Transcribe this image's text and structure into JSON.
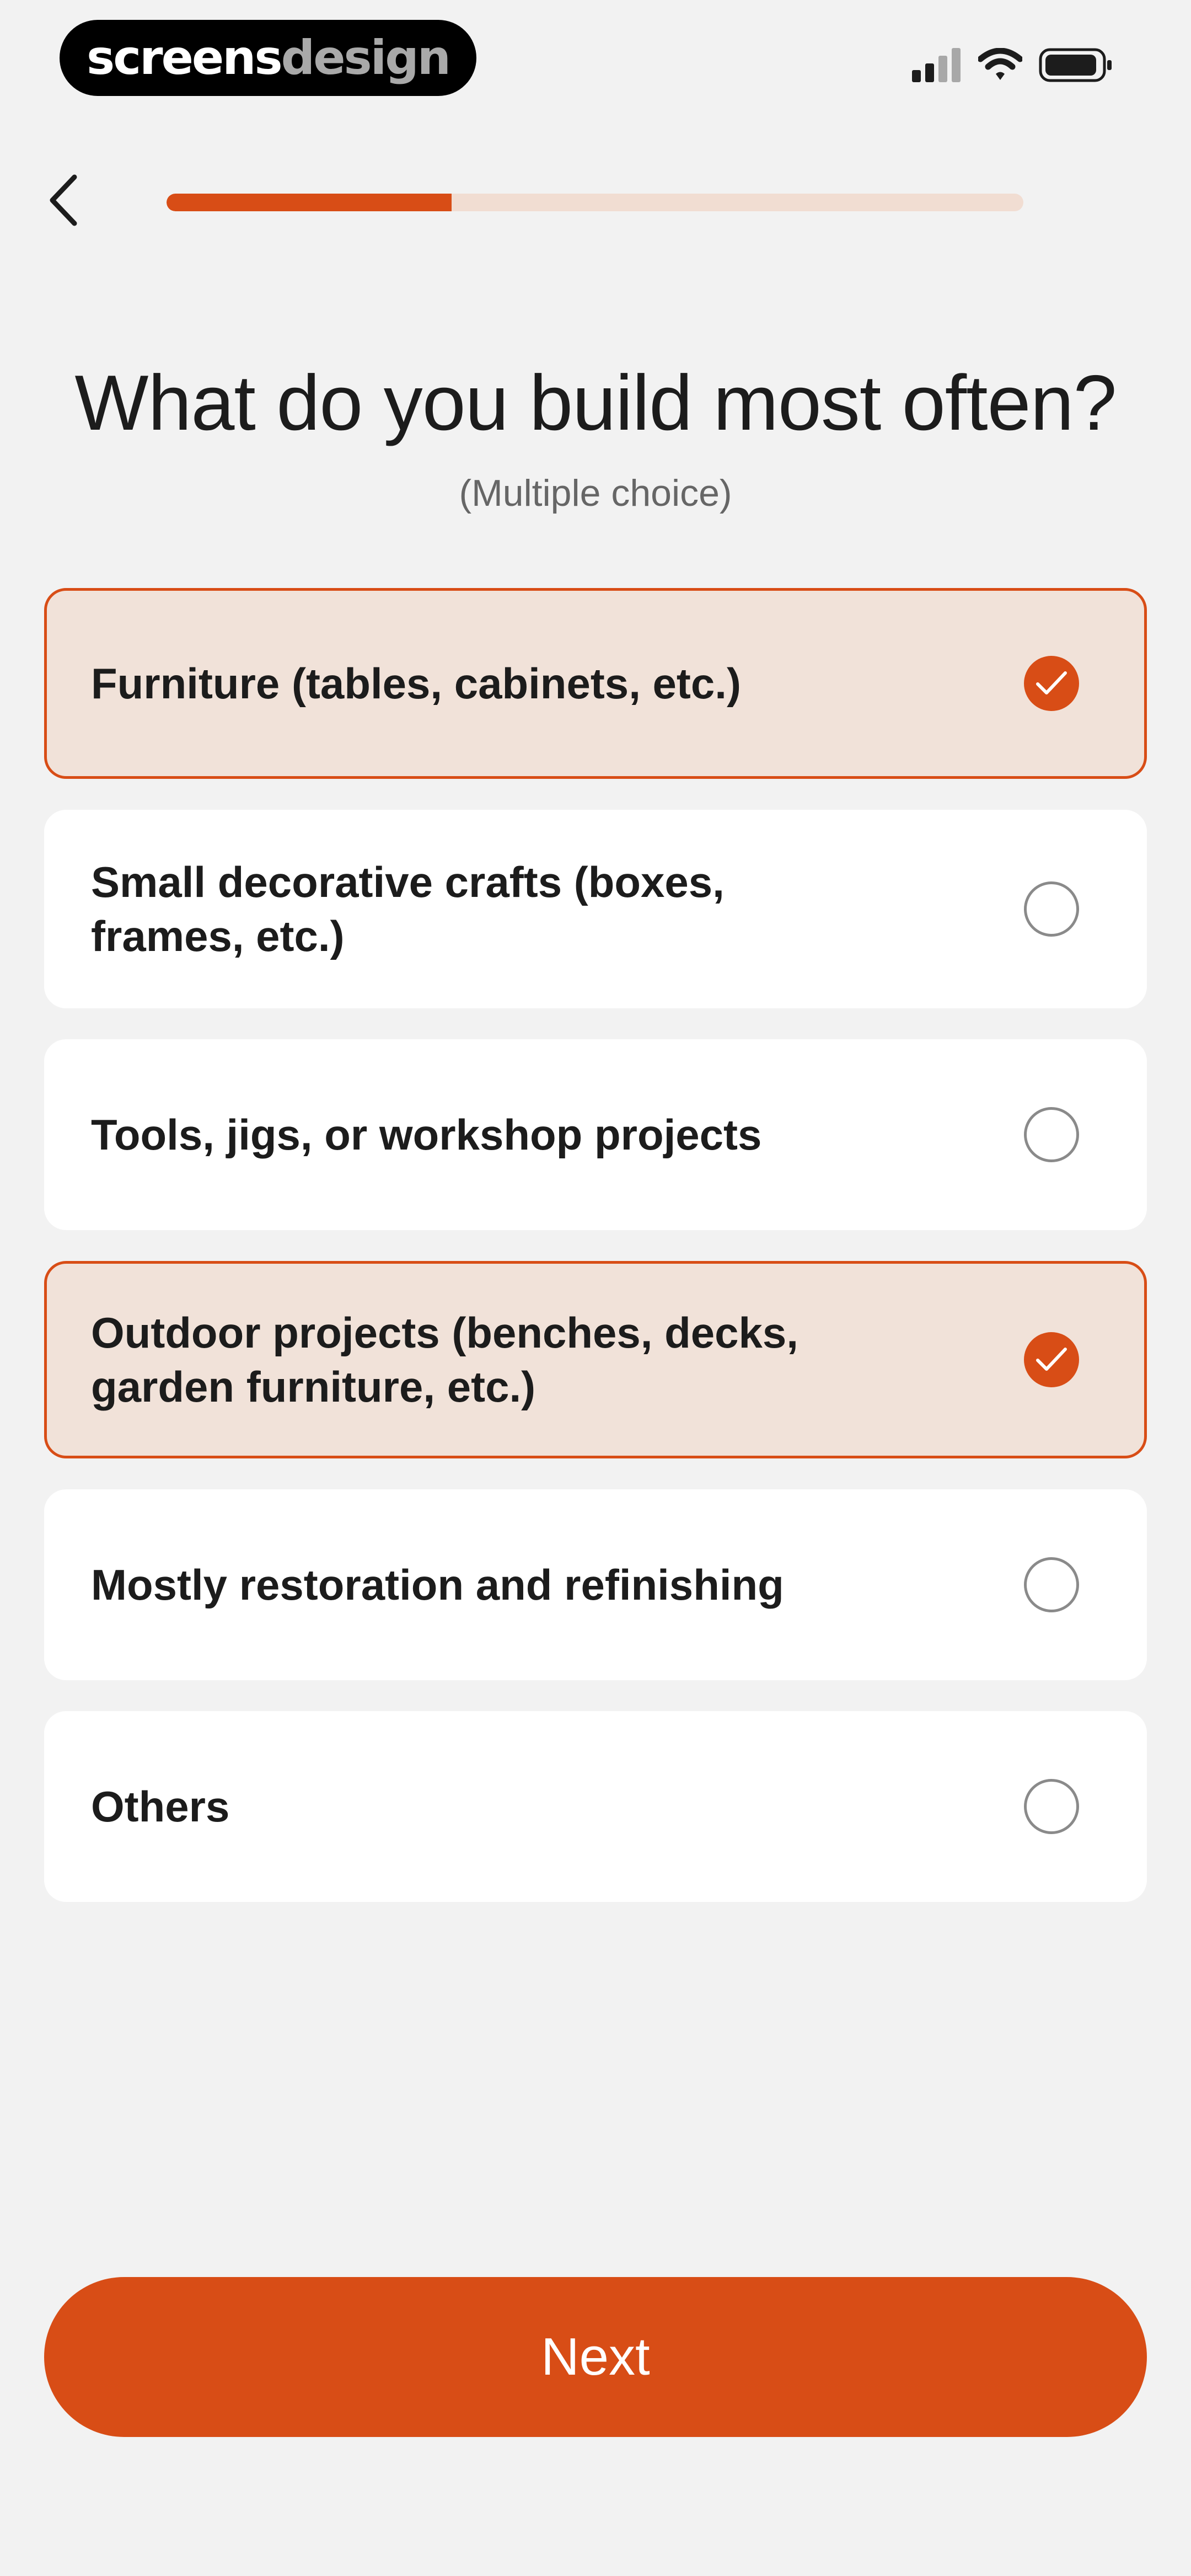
{
  "watermark": {
    "part1": "screens",
    "part2": "design"
  },
  "status_bar": {
    "icons": [
      "cellular-signal-icon",
      "wifi-icon",
      "battery-icon"
    ]
  },
  "nav": {
    "back_icon": "chevron-left-icon",
    "progress": 0.333
  },
  "question": {
    "title": "What do you build most often?",
    "subtitle": "(Multiple choice)"
  },
  "options": [
    {
      "label": "Furniture (tables, cabinets, etc.)",
      "selected": true
    },
    {
      "label": "Small decorative crafts (boxes, frames, etc.)",
      "selected": false
    },
    {
      "label": "Tools, jigs, or workshop projects",
      "selected": false
    },
    {
      "label": "Outdoor projects (benches, decks, garden furniture, etc.)",
      "selected": true
    },
    {
      "label": "Mostly restoration and refinishing",
      "selected": false
    },
    {
      "label": "Others",
      "selected": false
    }
  ],
  "next_button": {
    "label": "Next"
  },
  "colors": {
    "accent": "#d84d16",
    "selected_background": "#f1e2d9",
    "page_background": "#f2f2f2",
    "progress_track": "#f1ddd2"
  }
}
